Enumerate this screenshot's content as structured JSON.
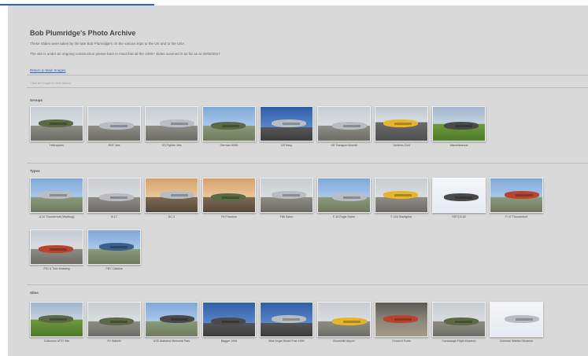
{
  "page": {
    "title": "Bob Plumridge's Photo Archive",
    "intro_line1": "These Slides were taken by the late Bob Plumridge's on the various trips to the UK and to the USA",
    "intro_line2": "The site is under an ongoing construction please bare in mind that all the 1000+ slides scanned in as far as at 30/06/2017",
    "return_link": "Return to Main Images",
    "hint": "Click an image to view album"
  },
  "sections": [
    {
      "title": "Groups",
      "items": [
        {
          "caption": "Helicopters",
          "scene": "sky-grey",
          "tone": "camo"
        },
        {
          "caption": "RAF Jets",
          "scene": "sky-grey",
          "tone": "silver"
        },
        {
          "caption": "US Fighter Jets",
          "scene": "sky-grey",
          "tone": "silver"
        },
        {
          "caption": "German WWII",
          "scene": "sky-blue",
          "tone": "camo"
        },
        {
          "caption": "US Navy",
          "scene": "sky-deep",
          "tone": "silver"
        },
        {
          "caption": "US Transport Aircraft",
          "scene": "sky-grey",
          "tone": "silver"
        },
        {
          "caption": "Vehicles Civil",
          "scene": "yellow",
          "tone": "yellowp"
        },
        {
          "caption": "Miscellaneous",
          "scene": "green-field",
          "tone": "dark"
        }
      ]
    },
    {
      "title": "Types",
      "items": [
        {
          "caption": "A-10 Thunderbolt (Warthog)",
          "scene": "sky-blue",
          "tone": "silver"
        },
        {
          "caption": "B-17",
          "scene": "sky-grey",
          "tone": "silver"
        },
        {
          "caption": "DC-3",
          "scene": "sky-sunset",
          "tone": "silver"
        },
        {
          "caption": "F4 Phantom",
          "scene": "sky-sunset",
          "tone": "camo"
        },
        {
          "caption": "F86 Sabre",
          "scene": "sky-grey",
          "tone": "silver"
        },
        {
          "caption": "F-16 Eagle Sabre",
          "scene": "sky-blue",
          "tone": "silver"
        },
        {
          "caption": "F-104 Starfighter",
          "scene": "sky-grey",
          "tone": "yellowp"
        },
        {
          "caption": "SR71 B-52",
          "scene": "white-sky",
          "tone": "dark"
        },
        {
          "caption": "P-47 Thunderbolt",
          "scene": "sky-blue",
          "tone": "red"
        },
        {
          "caption": "P51 & Twin Mustang",
          "scene": "sky-grey",
          "tone": "red"
        },
        {
          "caption": "PBY Catalina",
          "scene": "sky-blue",
          "tone": "blue"
        }
      ]
    },
    {
      "title": "Sites",
      "items": [
        {
          "caption": "Coltsmoor MTO Site",
          "scene": "green-field",
          "tone": "camo"
        },
        {
          "caption": "RJ Wakefil",
          "scene": "sky-grey",
          "tone": "camo"
        },
        {
          "caption": "USS Alabama Memorial Park",
          "scene": "sky-blue",
          "tone": "dark"
        },
        {
          "caption": "Bagger 1946",
          "scene": "sky-deep",
          "tone": "dark"
        },
        {
          "caption": "Blue Angel Model Fest 1990",
          "scene": "sky-deep",
          "tone": "silver"
        },
        {
          "caption": "Bournville Airport",
          "scene": "sky-grey",
          "tone": "yellowp"
        },
        {
          "caption": "Concord Fords",
          "scene": "indoor",
          "tone": "red"
        },
        {
          "caption": "Cavanaugh Flight Museum",
          "scene": "sky-grey",
          "tone": "camo"
        },
        {
          "caption": "Coleman Warbird Museum",
          "scene": "white-sky",
          "tone": "silver"
        }
      ]
    }
  ]
}
